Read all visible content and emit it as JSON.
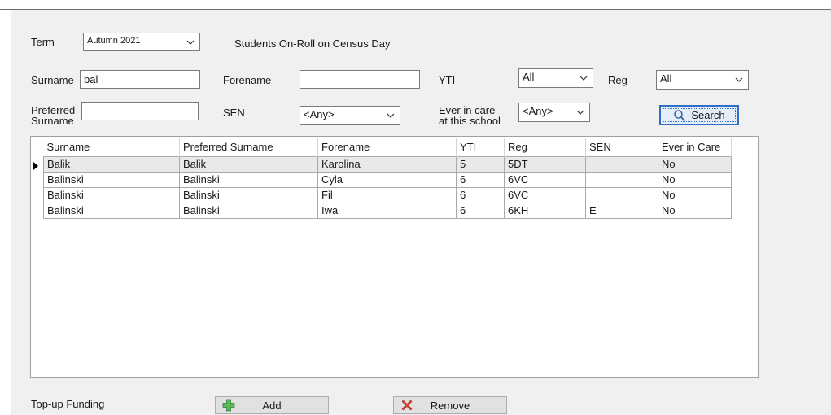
{
  "term": {
    "label": "Term",
    "value": "Autumn 2021"
  },
  "census_caption": "Students On-Roll on Census Day",
  "filters": {
    "surname": {
      "label": "Surname",
      "value": "bal"
    },
    "forename": {
      "label": "Forename",
      "value": ""
    },
    "yti": {
      "label": "YTI",
      "value": "All"
    },
    "reg": {
      "label": "Reg",
      "value": "All"
    },
    "preferred_surname": {
      "label_line1": "Preferred",
      "label_line2": "Surname",
      "value": ""
    },
    "sen": {
      "label": "SEN",
      "value": "<Any>"
    },
    "ever_in_care": {
      "label_line1": "Ever in care",
      "label_line2": "at this school",
      "value": "<Any>"
    },
    "search_label": "Search"
  },
  "grid": {
    "columns": [
      "Surname",
      "Preferred Surname",
      "Forename",
      "YTI",
      "Reg",
      "SEN",
      "Ever in Care"
    ],
    "rows": [
      {
        "surname": "Balik",
        "preferred": "Balik",
        "forename": "Karolina",
        "yti": "5",
        "reg": "5DT",
        "sen": "",
        "care": "No"
      },
      {
        "surname": "Balinski",
        "preferred": "Balinski",
        "forename": "Cyla",
        "yti": "6",
        "reg": "6VC",
        "sen": "",
        "care": "No"
      },
      {
        "surname": "Balinski",
        "preferred": "Balinski",
        "forename": "Fil",
        "yti": "6",
        "reg": "6VC",
        "sen": "",
        "care": "No"
      },
      {
        "surname": "Balinski",
        "preferred": "Balinski",
        "forename": "Iwa",
        "yti": "6",
        "reg": "6KH",
        "sen": "E",
        "care": "No"
      }
    ]
  },
  "topup": {
    "label": "Top-up Funding",
    "add_label": "Add",
    "remove_label": "Remove"
  },
  "colors": {
    "panel_bg": "#f0f0f0",
    "focus_blue": "#2f6fc7",
    "add_green": "#4caf50",
    "remove_red": "#d9342b"
  }
}
